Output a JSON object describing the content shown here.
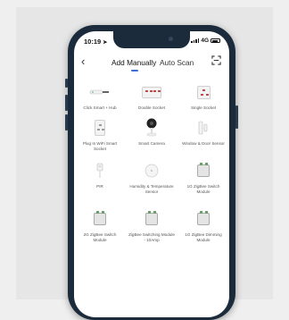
{
  "status": {
    "time": "10:19",
    "network": "4G"
  },
  "header": {
    "tabs": [
      {
        "label": "Add Manually",
        "active": true
      },
      {
        "label": "Auto Scan",
        "active": false
      }
    ],
    "accent": "#3a6fd8"
  },
  "devices": [
    {
      "label": "Click Smart + Hub",
      "icon": "hub-icon"
    },
    {
      "label": "Double Socket",
      "icon": "double-socket-icon"
    },
    {
      "label": "Single Socket",
      "icon": "single-socket-icon"
    },
    {
      "label": "Plug In WiFi Smart Socket",
      "icon": "plug-socket-icon"
    },
    {
      "label": "Smart Camera",
      "icon": "camera-icon"
    },
    {
      "label": "Window & Door Sensor",
      "icon": "door-sensor-icon"
    },
    {
      "label": "PIR",
      "icon": "pir-sensor-icon"
    },
    {
      "label": "Humidity & Temperature Sensor",
      "icon": "humidity-sensor-icon"
    },
    {
      "label": "1G ZigBee Switch Module",
      "icon": "switch-module-icon"
    },
    {
      "label": "2G ZigBee Switch Module",
      "icon": "switch-module-icon"
    },
    {
      "label": "ZigBee Switching Module - 10Amp",
      "icon": "switch-module-icon"
    },
    {
      "label": "1G ZigBee Dimming Module",
      "icon": "dimming-module-icon"
    }
  ]
}
